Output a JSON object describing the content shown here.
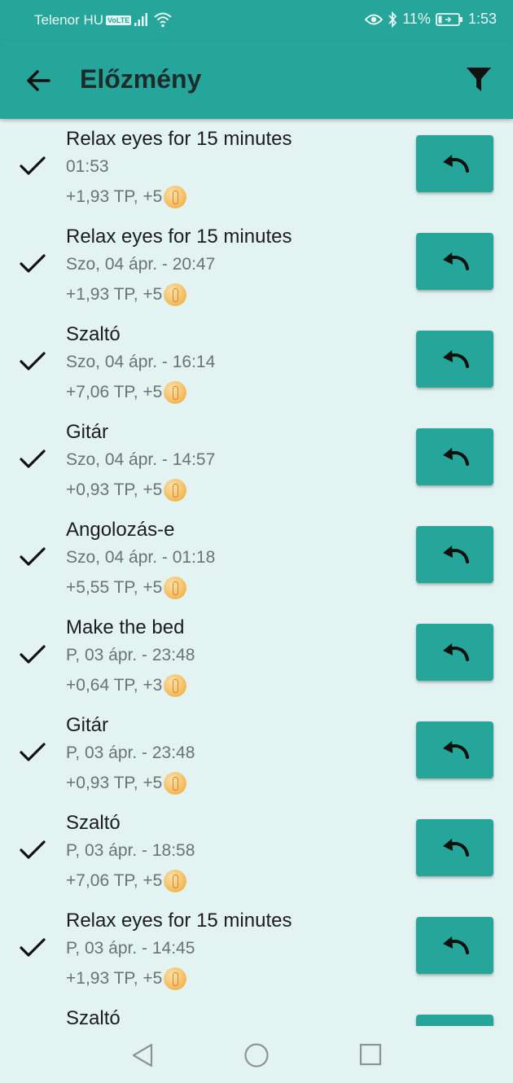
{
  "status_bar": {
    "carrier": "Telenor HU",
    "volte": "VoLTE",
    "battery": "11%",
    "time": "1:53"
  },
  "app_bar": {
    "title": "Előzmény",
    "back_icon": "arrow-left-icon",
    "filter_icon": "filter-icon"
  },
  "colors": {
    "primary": "#26a69a",
    "background": "#e3f3f1"
  },
  "history": [
    {
      "title": "Relax eyes for 15 minutes",
      "date": "01:53",
      "reward": "+1,93 TP, +5"
    },
    {
      "title": "Relax eyes for 15 minutes",
      "date": "Szo, 04 ápr. - 20:47",
      "reward": "+1,93 TP, +5"
    },
    {
      "title": "Szaltó",
      "date": "Szo, 04 ápr. - 16:14",
      "reward": "+7,06 TP, +5"
    },
    {
      "title": "Gitár",
      "date": "Szo, 04 ápr. - 14:57",
      "reward": "+0,93 TP, +5"
    },
    {
      "title": "Angolozás-e",
      "date": "Szo, 04 ápr. - 01:18",
      "reward": "+5,55 TP, +5"
    },
    {
      "title": "Make the bed",
      "date": "P, 03 ápr. - 23:48",
      "reward": "+0,64 TP, +3"
    },
    {
      "title": "Gitár",
      "date": "P, 03 ápr. - 23:48",
      "reward": "+0,93 TP, +5"
    },
    {
      "title": "Szaltó",
      "date": "P, 03 ápr. - 18:58",
      "reward": "+7,06 TP, +5"
    },
    {
      "title": "Relax eyes for 15 minutes",
      "date": "P, 03 ápr. - 14:45",
      "reward": "+1,93 TP, +5"
    },
    {
      "title": "Szaltó",
      "date": "",
      "reward": ""
    }
  ]
}
